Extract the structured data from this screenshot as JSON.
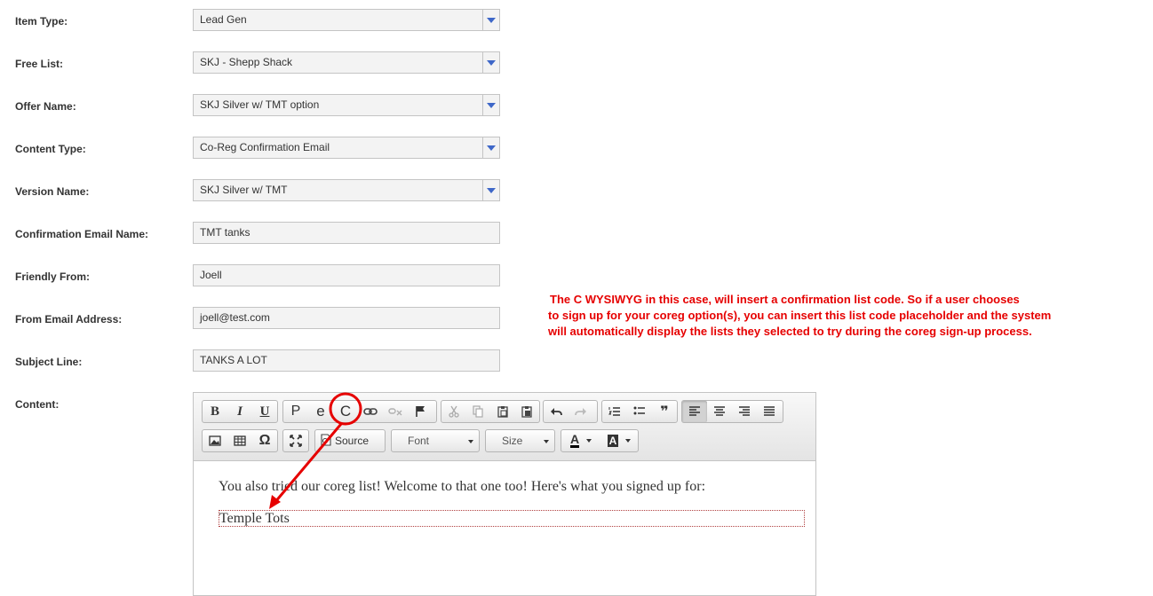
{
  "form": {
    "item_type": {
      "label": "Item Type:",
      "value": "Lead Gen"
    },
    "free_list": {
      "label": "Free List:",
      "value": "SKJ - Shepp Shack"
    },
    "offer_name": {
      "label": "Offer Name:",
      "value": "SKJ Silver w/ TMT option"
    },
    "content_type": {
      "label": "Content Type:",
      "value": "Co-Reg Confirmation Email"
    },
    "version_name": {
      "label": "Version Name:",
      "value": "SKJ Silver w/ TMT"
    },
    "confirmation_email_name": {
      "label": "Confirmation Email Name:",
      "value": "TMT tanks"
    },
    "friendly_from": {
      "label": "Friendly From:",
      "value": "Joell"
    },
    "from_email": {
      "label": "From Email Address:",
      "value": "joell@test.com"
    },
    "subject_line": {
      "label": "Subject Line:",
      "value": "TANKS A LOT"
    },
    "content": {
      "label": "Content:"
    }
  },
  "annotation": {
    "line1": "The C WYSIWYG in this case, will insert a confirmation list code. So if a user chooses",
    "line2": "to sign up for your coreg option(s), you can insert this list code placeholder and the system",
    "line3": "will automatically display the lists they selected to try during the coreg sign-up process.",
    "color": "#e60000"
  },
  "editor": {
    "toolbar": {
      "bold": "B",
      "italic": "I",
      "underline": "U",
      "p_button": "P",
      "e_button": "e",
      "c_button": "C",
      "source_label": "Source",
      "font_label": "Font",
      "size_label": "Size",
      "text_color_label": "A",
      "bg_color_label": "A",
      "omega": "Ω",
      "quote": "❞"
    },
    "body": {
      "line1": "You also tried our coreg list! Welcome to that one too! Here's what you signed up for:",
      "placeholder_text": "Temple Tots"
    }
  },
  "icons": [
    "dropdown-arrow-icon",
    "link-icon",
    "unlink-icon",
    "flag-icon",
    "cut-icon",
    "copy-icon",
    "paste-icon",
    "paste-word-icon",
    "undo-icon",
    "redo-icon",
    "numbered-list-icon",
    "bulleted-list-icon",
    "quote-icon",
    "align-left-icon",
    "align-center-icon",
    "align-right-icon",
    "justify-icon",
    "image-icon",
    "table-icon",
    "omega-icon",
    "maximize-icon",
    "source-icon"
  ]
}
